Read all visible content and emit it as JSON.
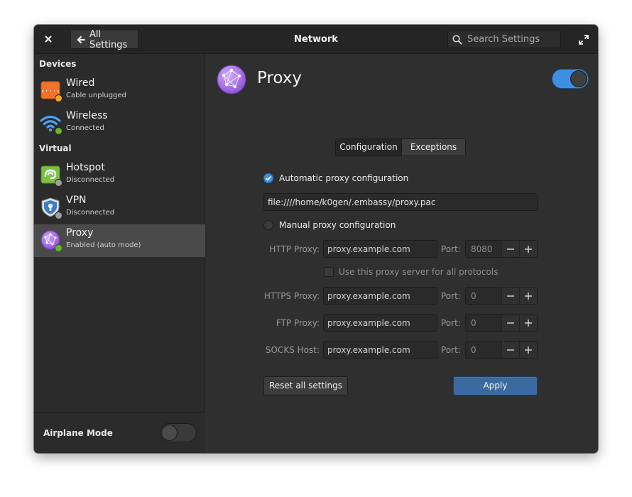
{
  "window": {
    "title": "Network",
    "back_button_label": "All Settings",
    "search_placeholder": "Search Settings"
  },
  "sidebar": {
    "sections": [
      {
        "heading": "Devices",
        "items": [
          {
            "label": "Wired",
            "status": "Cable unplugged",
            "status_color": "#f5a623",
            "icon": "wired-network-icon"
          },
          {
            "label": "Wireless",
            "status": "Connected",
            "status_color": "#68b723",
            "icon": "wireless-icon"
          }
        ]
      },
      {
        "heading": "Virtual",
        "items": [
          {
            "label": "Hotspot",
            "status": "Disconnected",
            "status_color": "#a0a0a0",
            "icon": "hotspot-icon"
          },
          {
            "label": "VPN",
            "status": "Disconnected",
            "status_color": "#a0a0a0",
            "icon": "vpn-shield-icon"
          },
          {
            "label": "Proxy",
            "status": "Enabled (auto mode)",
            "status_color": "#68b723",
            "icon": "proxy-globe-icon",
            "selected": true
          }
        ]
      }
    ],
    "airplane_mode": {
      "label": "Airplane Mode",
      "enabled": false
    }
  },
  "proxy": {
    "title": "Proxy",
    "enabled": true,
    "tabs": [
      {
        "label": "Configuration",
        "active": true
      },
      {
        "label": "Exceptions",
        "active": false
      }
    ],
    "auto_label": "Automatic proxy configuration",
    "auto_selected": true,
    "pac_url": "file:////home/k0gen/.embassy/proxy.pac",
    "manual_label": "Manual proxy configuration",
    "manual_selected": false,
    "port_label": "Port:",
    "use_for_all_label": "Use this proxy server for all protocols",
    "rows": [
      {
        "label": "HTTP Proxy:",
        "host": "proxy.example.com",
        "port": "8080"
      },
      {
        "label": "HTTPS Proxy:",
        "host": "proxy.example.com",
        "port": "0"
      },
      {
        "label": "FTP Proxy:",
        "host": "proxy.example.com",
        "port": "0"
      },
      {
        "label": "SOCKS Host:",
        "host": "proxy.example.com",
        "port": "0"
      }
    ],
    "reset_label": "Reset all settings",
    "apply_label": "Apply"
  },
  "colors": {
    "accent": "#3d8fe6",
    "apply_button": "#3b6aa0"
  }
}
